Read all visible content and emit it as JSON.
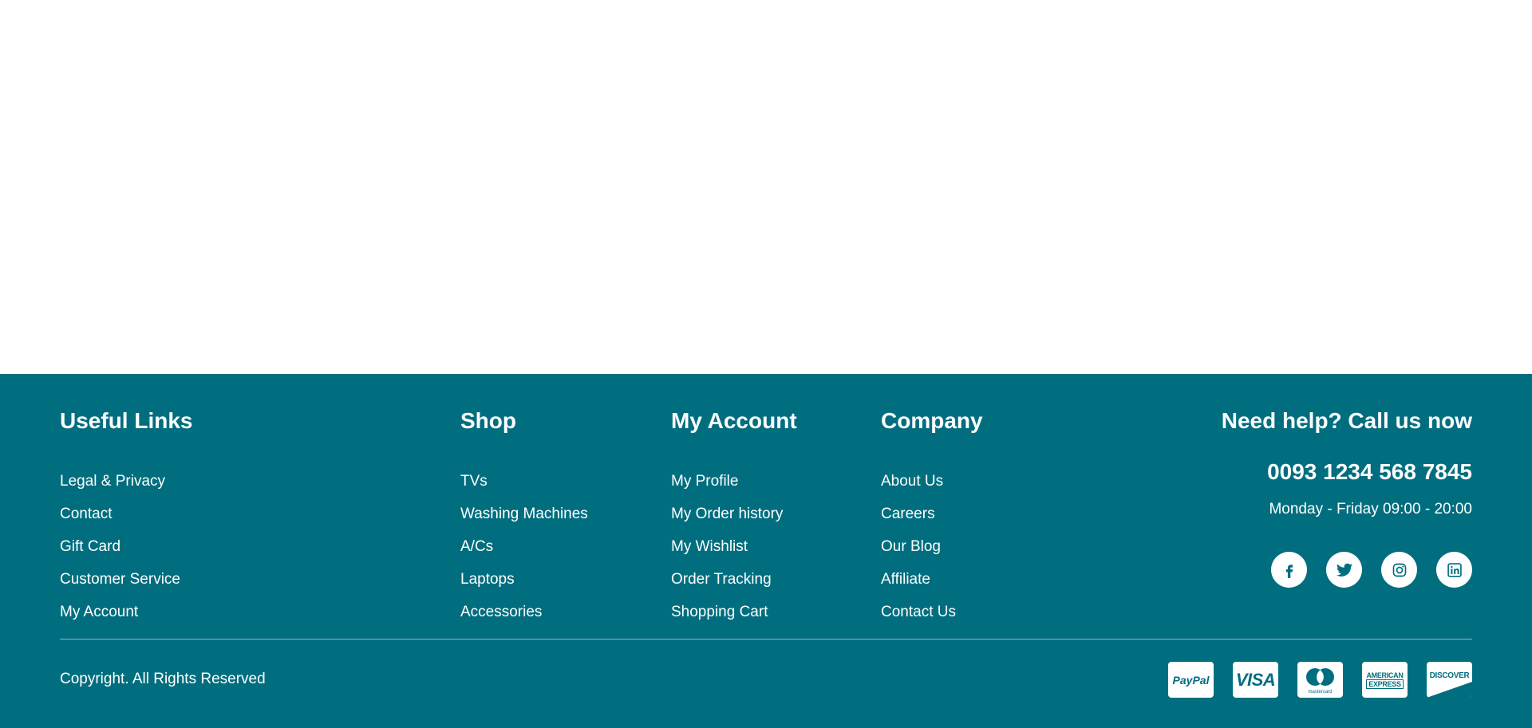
{
  "footer": {
    "colors": {
      "background": "#006e7f",
      "text": "#ffffff"
    },
    "columns": {
      "useful": {
        "title": "Useful Links",
        "items": [
          "Legal & Privacy",
          "Contact",
          "Gift Card",
          "Customer Service",
          "My Account"
        ]
      },
      "shop": {
        "title": "Shop",
        "items": [
          "TVs",
          "Washing Machines",
          "A/Cs",
          "Laptops",
          "Accessories"
        ]
      },
      "account": {
        "title": "My Account",
        "items": [
          "My Profile",
          "My Order history",
          "My Wishlist",
          "Order Tracking",
          "Shopping Cart"
        ]
      },
      "company": {
        "title": "Company",
        "items": [
          "About Us",
          "Careers",
          "Our Blog",
          "Affiliate",
          "Contact Us"
        ]
      }
    },
    "help": {
      "title": "Need help? Call us now",
      "phone": "0093 1234 568 7845",
      "hours": "Monday - Friday 09:00 - 20:00"
    },
    "social_icons": [
      "facebook-icon",
      "twitter-icon",
      "instagram-icon",
      "linkedin-icon"
    ],
    "copyright": "Copyright. All Rights Reserved",
    "payments": {
      "paypal": "PayPal",
      "visa": "VISA",
      "mastercard": "mastercard",
      "amex_line1": "AMERICAN",
      "amex_line2": "EXPRESS",
      "discover": "DISCOVER"
    }
  }
}
